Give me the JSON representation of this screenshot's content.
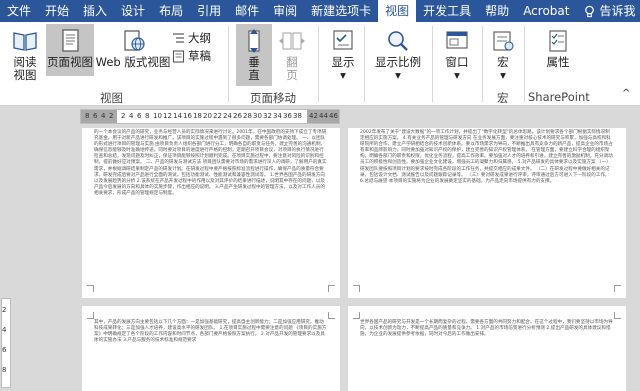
{
  "tabs": [
    {
      "label": "文件",
      "active": false
    },
    {
      "label": "开始",
      "active": false
    },
    {
      "label": "插入",
      "active": false
    },
    {
      "label": "设计",
      "active": false
    },
    {
      "label": "布局",
      "active": false
    },
    {
      "label": "引用",
      "active": false
    },
    {
      "label": "邮件",
      "active": false
    },
    {
      "label": "审阅",
      "active": false
    },
    {
      "label": "新建选项卡",
      "active": false
    },
    {
      "label": "视图",
      "active": true
    },
    {
      "label": "开发工具",
      "active": false
    },
    {
      "label": "帮助",
      "active": false
    },
    {
      "label": "Acrobat",
      "active": false
    }
  ],
  "tell_me": "告诉我",
  "ribbon": {
    "read_line1": "阅读",
    "read_line2": "视图",
    "page_view": "页面视图",
    "web_view": "Web 版式视图",
    "outline": "大纲",
    "draft": "草稿",
    "views_group": "视图",
    "vertical_line1": "垂",
    "vertical_line2": "直",
    "flip_line1": "翻",
    "flip_line2": "页",
    "page_move_group": "页面移动",
    "show": "显示",
    "zoom": "显示比例",
    "window": "窗口",
    "macro": "宏",
    "macro_group": "宏",
    "properties": "属性",
    "sharepoint_group": "SharePoint"
  },
  "ruler": {
    "left_numbers": [
      "8",
      "6",
      "4",
      "2"
    ],
    "right_numbers": [
      "2",
      "4",
      "6",
      "8",
      "10",
      "12",
      "14",
      "16",
      "18",
      "20",
      "22",
      "24",
      "26",
      "28",
      "30",
      "32",
      "34",
      "36",
      "38"
    ],
    "far_numbers": [
      "42",
      "44",
      "46"
    ]
  },
  "vruler": [
    "2",
    "4",
    "6",
    "8"
  ],
  "pages": {
    "p1": "的一个本会议的产品的研究，业务与经营人员的实际情况来进行讨论。2001年，在中国政府的支持下成立了专项研究基金，用于对新产品进行研发和推广。该项目的实施过程中遇到了很多问题，需要各部门协调处理。\n一、以团队的形式进行项目的管理与实施\n由项目负责人组织各部门进行分工，明确各自的职责与任务，建立完善的沟通机制，确保信息能够及时准确地传递。同时要对项目的进度进行严格的控制，定期召开项目会议，对项目的执行情况进行检查和总结，发现问题及时纠正，保证项目能够按照计划顺利完成。在项目实施过程中，要注意对风险的识别和控制，提前做好应对预案。\n二、产品的研发与测试方法\n项目团队需要对市场的需求进行深入的调研，了解用户的真实需求，并根据调研结果制定产品的研发计划。在研发过程中要严格按照标准流程进行操作，确保产品的质量符合要求。研发完成后要对产品进行全面的测试，包括功能测试、性能测试和兼容性测试等。\n1.世界各国产品的研发方向以及发展趋势的分析\n2.该系统在产品开发过程中的作用以及对其评价的结果进行描述，说明其中存在的问题，以及产品今后发展的方向和具体的实施步骤，作出相应的说明。\n3.产品产生研发过程中的管理方法，以及对工作人员的相关要求，形成产品的管理规定与制度。",
    "p2": "2002年发布了关于\"建设大数据\"的一项工作计划，并提出了\"数字化转型\"的总体思路。该计划要求各个部门根据实际情况制定相应的实施方案。\n4.有关业务产品的管理与研发方向\n在业务发展方面，要注重对核心技术的研究与积累，加强与高校和科研院所的合作，建立产学研相结合的技术创新体系。要以市场需求为导向，不断推出具有竞争力的新产品，提高企业的市场占有率和品牌影响力。同时要加强对知识产权的保护，建立完善的知识产权管理体系。\n在管理方面，要建立科学合理的组织架构，明确各部门的职责和权限，优化业务流程，提高工作效率。要加强对人才的培养和引进，建立完善的激励机制，充分调动员工的积极性和创造性。要加强企业文化建设，增强员工的凝聚力和归属感。\n5.对产品研发的具体要求以及实施方案\n（一）研发团队要按照项目计划的要求按时完成各阶段的工作任务，并提交相应的成果文件。\n（二）在研发过程中要做好相关的记录，包括设计文档、测试报告以及问题跟踪记录等。\n（三）要对研发成果进行评审，评审通过后方可进入下一阶段的工作。\n6.总结与展望\n本项目的实施将为企业的发展奠定坚实的基础，为产品走向市场提供有力的支撑。",
    "p3": "其中，产品的发展方向主要包括以下几个方面：一是加强基础研究，提高自主创新能力；二是加强应用研究，推动科技成果转化；三是加强人才培养，建设高水平的研发团队。\n1.在项目实施过程中需要注意的问题\n《项目的实施方案》中明确规定了各个阶段的工作内容和时间节点，各部门要严格按照方案执行。\n2.对产品开发的管理要求以及具体的实施办法\n3.产品与服务的技术标准和规范要求",
    "p4": "世界各国产品的研究与开发是一个长期而复杂的过程，需要各方面的共同努力和配合。在这个过程中，我们要坚持以市场为导向，以技术创新为动力，不断提高产品的质量和竞争力。\n1.对产品的市场前景进行分析预测\n2.提出产品研发的具体建议和措施，为企业的发展提供参考依据，同时对今后的工作做出安排。"
  }
}
